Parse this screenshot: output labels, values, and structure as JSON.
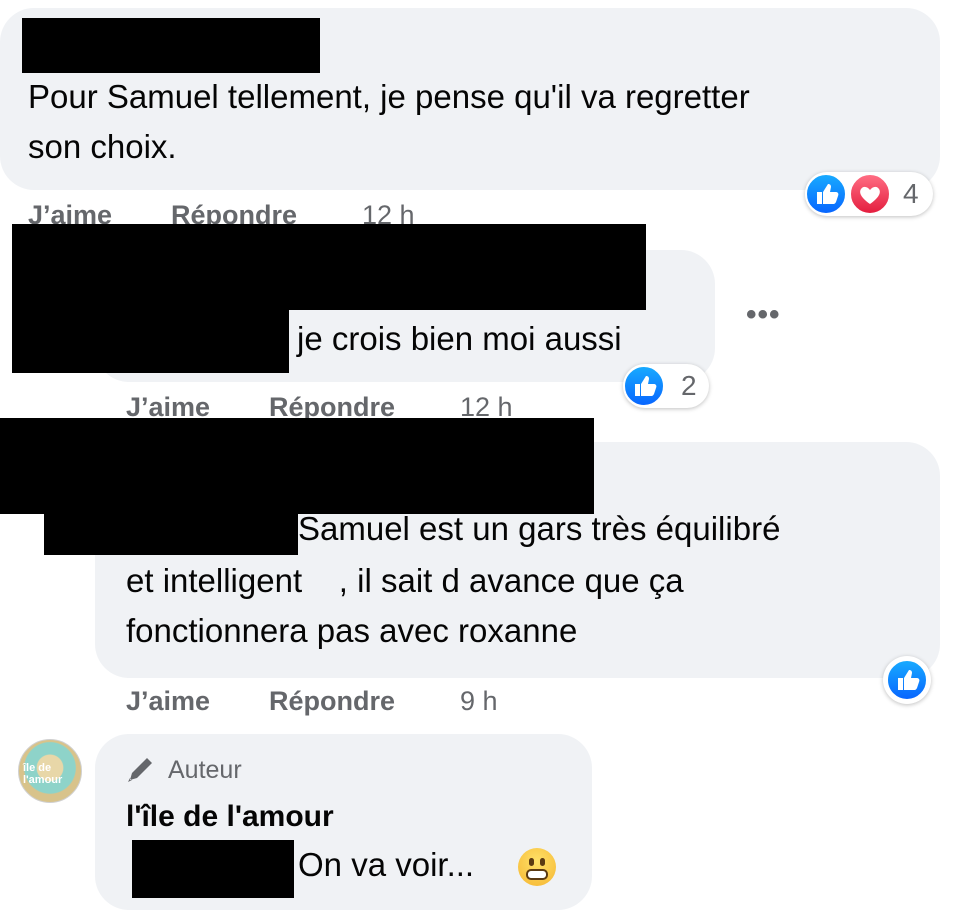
{
  "comments": [
    {
      "text_lines": [
        "Pour Samuel tellement, je pense qu'il va regretter",
        "son choix."
      ],
      "reactions": {
        "icons": [
          "like-icon",
          "love-icon"
        ],
        "count": "4"
      },
      "actions": {
        "like": "J’aime",
        "reply": "Répondre",
        "time": "12 h"
      }
    },
    {
      "text_lines": [
        "je crois bien moi aussi"
      ],
      "reactions": {
        "icons": [
          "like-icon"
        ],
        "count": "2"
      },
      "more": "•••",
      "actions": {
        "like": "J’aime",
        "reply": "Répondre",
        "time": "12 h"
      }
    },
    {
      "text_lines": [
        "Samuel est un gars très équilibré",
        "et intelligent    , il sait d avance que ça",
        "fonctionnera pas avec roxanne"
      ],
      "reactions": {
        "icons": [
          "like-icon"
        ]
      },
      "actions": {
        "like": "J’aime",
        "reply": "Répondre",
        "time": "9 h"
      }
    },
    {
      "avatar_label": "île de l'amour",
      "badge": "Auteur",
      "author_name": "l'île de l'amour",
      "text_lines": [
        "On va voir... "
      ],
      "emoji": "grimacing-face-emoji"
    }
  ],
  "colors": {
    "bubble": "#f0f2f5",
    "secondary_text": "#65676b",
    "like_blue": "#0866ff",
    "love_red": "#e41e3f"
  }
}
